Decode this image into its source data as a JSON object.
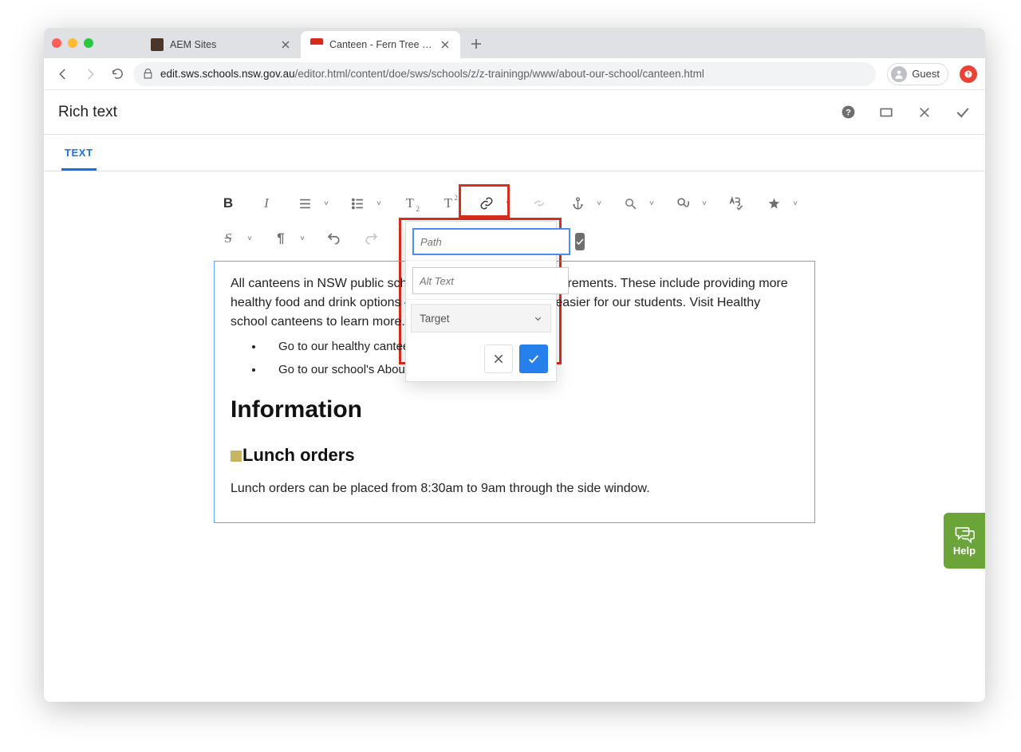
{
  "browser": {
    "tabs": [
      {
        "title": "AEM Sites",
        "active": false
      },
      {
        "title": "Canteen - Fern Tree Public Sch",
        "active": true
      }
    ],
    "url_host": "edit.sws.schools.nsw.gov.au",
    "url_path": "/editor.html/content/doe/sws/schools/z/z-trainingp/www/about-our-school/canteen.html",
    "guest_label": "Guest"
  },
  "aem": {
    "title": "Rich text",
    "tab_label": "TEXT",
    "toolbar": {
      "bold": "B",
      "italic": "I",
      "subscript": "T",
      "superscript": "T",
      "strike": "S"
    },
    "content": {
      "intro": "All canteens in NSW public schools must meet certain requirements. These include providing more healthy food and drink options – to make healthy choices easier for our students. Visit Healthy school canteens to learn more. You can also:",
      "bullets": [
        "Go to our healthy canteens fact sheet to learn more.",
        "Go to our school's About us page."
      ],
      "h2": "Information",
      "h3": "Lunch orders",
      "para2": "Lunch orders can be placed from 8:30am to 9am through the side window."
    },
    "link_popover": {
      "path_placeholder": "Path",
      "alt_placeholder": "Alt Text",
      "target_label": "Target"
    }
  },
  "help": {
    "label": "Help"
  }
}
